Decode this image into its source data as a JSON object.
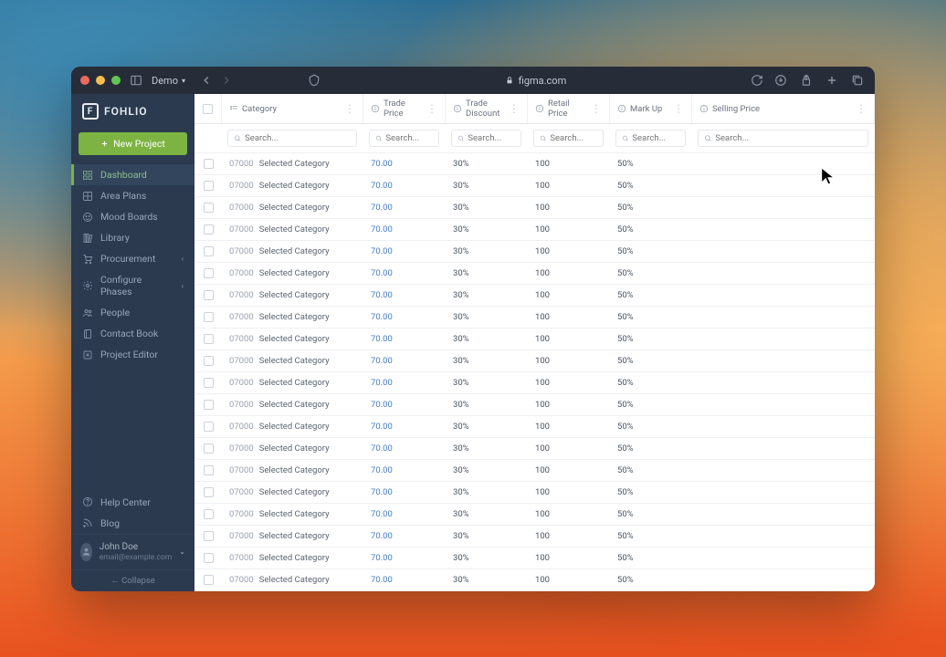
{
  "browser": {
    "tab_name": "Demo",
    "address_host": "figma.com"
  },
  "brand": "FOHLIO",
  "new_project_label": "New Project",
  "sidebar": {
    "items": [
      {
        "label": "Dashboard",
        "icon": "dashboard",
        "active": true
      },
      {
        "label": "Area Plans",
        "icon": "grid"
      },
      {
        "label": "Mood Boards",
        "icon": "mood"
      },
      {
        "label": "Library",
        "icon": "library"
      },
      {
        "label": "Procurement",
        "icon": "cart",
        "expandable": true
      },
      {
        "label": "Configure Phases",
        "icon": "gear",
        "expandable": true
      },
      {
        "label": "People",
        "icon": "people"
      },
      {
        "label": "Contact Book",
        "icon": "book"
      },
      {
        "label": "Project Editor",
        "icon": "editor"
      }
    ],
    "footer": [
      {
        "label": "Help Center",
        "icon": "help"
      },
      {
        "label": "Blog",
        "icon": "rss"
      }
    ],
    "collapse_label": "Collapse"
  },
  "user": {
    "name": "John Doe",
    "email": "email@example.com"
  },
  "columns": [
    {
      "key": "category",
      "label": "Category",
      "icon": "list"
    },
    {
      "key": "trade_price",
      "label": "Trade Price",
      "icon": "info"
    },
    {
      "key": "trade_discount",
      "label": "Trade Discount",
      "icon": "info"
    },
    {
      "key": "retail_price",
      "label": "Retail Price",
      "icon": "info"
    },
    {
      "key": "mark_up",
      "label": "Mark Up",
      "icon": "info"
    },
    {
      "key": "selling_price",
      "label": "Selling Price",
      "icon": "info"
    }
  ],
  "search_placeholder": "Search...",
  "row_template": {
    "code": "07000",
    "category": "Selected Category",
    "trade_price": "70.00",
    "trade_discount": "30%",
    "retail_price": "100",
    "mark_up": "50%",
    "selling_price": ""
  },
  "row_count": 20
}
